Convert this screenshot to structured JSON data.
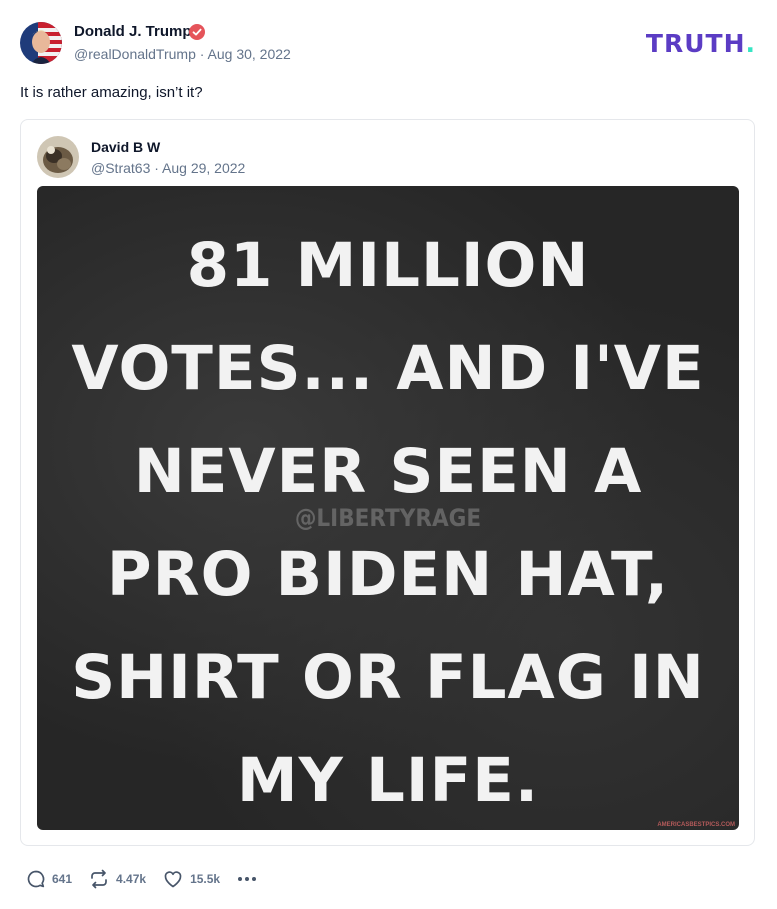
{
  "post": {
    "author_name": "Donald J. Trump",
    "author_handle": "@realDonaldTrump",
    "date": "Aug 30, 2022",
    "text": "It is rather amazing, isn’t it?",
    "brand": {
      "word": "TRUTH",
      "dot": ".",
      "color": "#5b3cc4",
      "dot_color": "#36e5c4"
    },
    "verified_color": "#e5545a"
  },
  "quote": {
    "author_name": "David B W",
    "author_handle": "@Strat63",
    "date": "Aug 29, 2022",
    "image": {
      "lines": [
        "81 MILLION",
        "VOTES... AND I'VE",
        "NEVER SEEN A",
        "PRO BIDEN HAT,",
        "SHIRT OR FLAG IN",
        "MY LIFE."
      ],
      "watermark": "@LIBERTYRAGE",
      "credit": "AMERICASBESTPICS.COM"
    }
  },
  "actions": {
    "replies": "641",
    "retruths": "4.47k",
    "likes": "15.5k"
  },
  "icons": [
    "reply-icon",
    "retruth-icon",
    "like-icon",
    "more-icon",
    "verified-badge-icon"
  ]
}
